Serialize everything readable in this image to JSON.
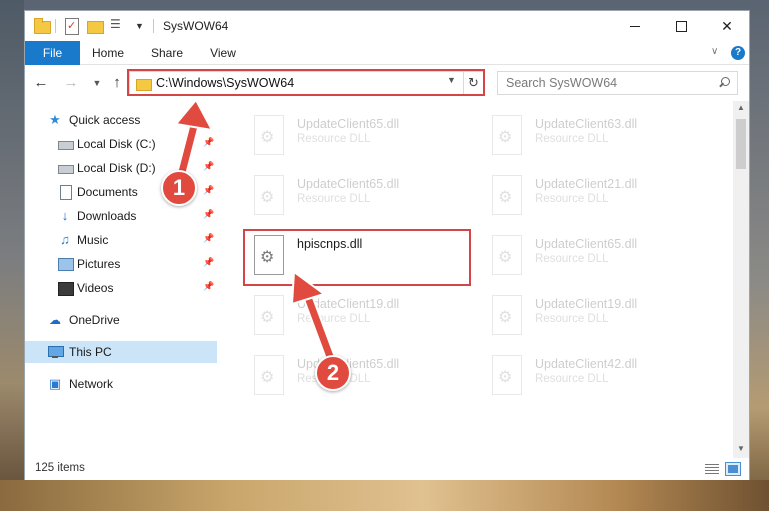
{
  "window": {
    "title": "SysWOW64",
    "minimize_label": "",
    "maximize_label": "",
    "close_label": "✕"
  },
  "ribbon": {
    "tabs": [
      "File",
      "Home",
      "Share",
      "View"
    ]
  },
  "nav": {
    "address": "C:\\Windows\\SysWOW64",
    "search_placeholder": "Search SysWOW64",
    "back_glyph": "←",
    "forward_glyph": "→",
    "recent_glyph": "⌄",
    "up_glyph": "↑",
    "refresh_glyph": "↻"
  },
  "sidebar": {
    "items": [
      {
        "label": "Quick access",
        "icon": "star-icon",
        "pinned": false
      },
      {
        "label": "Local Disk (C:)",
        "icon": "disk-icon",
        "pinned": true
      },
      {
        "label": "Local Disk (D:)",
        "icon": "disk-icon",
        "pinned": true
      },
      {
        "label": "Documents",
        "icon": "documents-icon",
        "pinned": true
      },
      {
        "label": "Downloads",
        "icon": "download-icon",
        "pinned": true
      },
      {
        "label": "Music",
        "icon": "music-icon",
        "pinned": true
      },
      {
        "label": "Pictures",
        "icon": "pictures-icon",
        "pinned": true
      },
      {
        "label": "Videos",
        "icon": "videos-icon",
        "pinned": true
      },
      {
        "label": "OneDrive",
        "icon": "cloud-icon",
        "pinned": false
      },
      {
        "label": "This PC",
        "icon": "computer-icon",
        "pinned": false,
        "selected": true
      },
      {
        "label": "Network",
        "icon": "network-icon",
        "pinned": false
      }
    ]
  },
  "files": [
    {
      "name": "UpdateClient65.dll",
      "type": "Resource DLL",
      "faded": true
    },
    {
      "name": "UpdateClient63.dll",
      "type": "Resource DLL",
      "faded": true
    },
    {
      "name": "UpdateClient65.dll",
      "type": "Resource DLL",
      "faded": true
    },
    {
      "name": "UpdateClient21.dll",
      "type": "Resource DLL",
      "faded": true
    },
    {
      "name": "hpiscnps.dll",
      "type": "",
      "faded": false
    },
    {
      "name": "UpdateClient65.dll",
      "type": "Resource DLL",
      "faded": true
    },
    {
      "name": "UpdateClient19.dll",
      "type": "Resource DLL",
      "faded": true
    },
    {
      "name": "UpdateClient19.dll",
      "type": "Resource DLL",
      "faded": true
    },
    {
      "name": "UpdateClient65.dll",
      "type": "Resource DLL",
      "faded": true
    },
    {
      "name": "UpdateClient42.dll",
      "type": "Resource DLL",
      "faded": true
    }
  ],
  "status": {
    "item_count": "125 items"
  },
  "annotations": {
    "step1": "1",
    "step2": "2",
    "color": "#e04a3f"
  }
}
